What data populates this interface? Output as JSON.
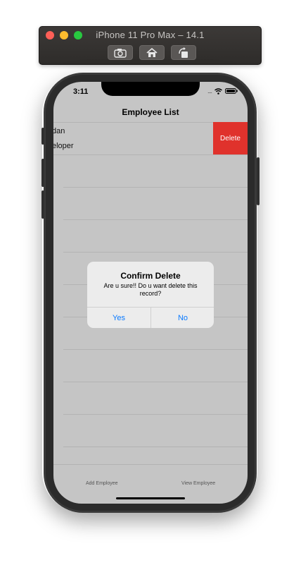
{
  "simulator": {
    "title": "iPhone 11 Pro Max – 14.1",
    "buttons": [
      "screenshot-icon",
      "home-icon",
      "rotate-icon"
    ]
  },
  "status_bar": {
    "time": "3:11",
    "signal": "....",
    "icons": [
      "wifi-icon",
      "battery-icon"
    ]
  },
  "nav": {
    "title": "Employee List"
  },
  "list": {
    "rows": [
      {
        "name": "dan",
        "role": "eloper",
        "swipe_action": "Delete"
      }
    ]
  },
  "alert": {
    "title": "Confirm Delete",
    "message": "Are u sure!! Do u want delete this record?",
    "yes_label": "Yes",
    "no_label": "No"
  },
  "tabs": {
    "add_label": "Add Employee",
    "view_label": "View Employee"
  },
  "colors": {
    "screen_dim": "#c5c5c5",
    "delete": "#e0322c",
    "accent": "#0a7aff"
  }
}
